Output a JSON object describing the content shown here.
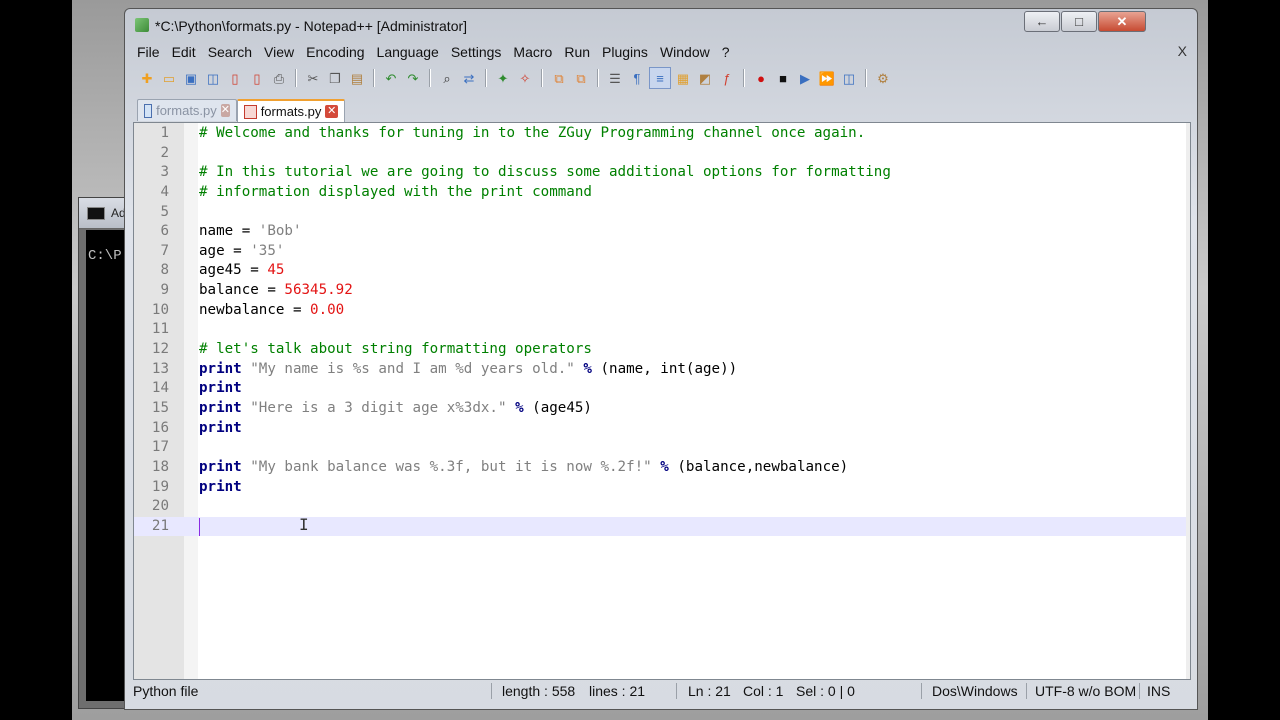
{
  "window": {
    "title": "*C:\\Python\\formats.py - Notepad++ [Administrator]",
    "minimize": "←",
    "maximize": "□",
    "close": "✕"
  },
  "background_console": {
    "title": "Ad",
    "prompt": "C:\\P"
  },
  "menu": {
    "items": [
      "File",
      "Edit",
      "Search",
      "View",
      "Encoding",
      "Language",
      "Settings",
      "Macro",
      "Run",
      "Plugins",
      "Window",
      "?"
    ],
    "close": "X"
  },
  "toolbar": {
    "icons": [
      "new-file-icon",
      "open-file-icon",
      "save-icon",
      "save-all-icon",
      "close-file-icon",
      "close-all-icon",
      "print-icon",
      "cut-icon",
      "copy-icon",
      "paste-icon",
      "undo-icon",
      "redo-icon",
      "find-icon",
      "replace-icon",
      "zoom-in-icon",
      "zoom-out-icon",
      "sync-vertical-icon",
      "sync-horizontal-icon",
      "word-wrap-icon",
      "show-all-chars-icon",
      "indent-guide-icon",
      "user-lang-icon",
      "doc-map-icon",
      "function-list-icon",
      "record-macro-icon",
      "stop-macro-icon",
      "play-macro-icon",
      "run-macro-multiple-icon",
      "save-macro-icon",
      "plugin-icon"
    ]
  },
  "tabs": [
    {
      "label": "formats.py",
      "active": false
    },
    {
      "label": "formats.py",
      "active": true
    }
  ],
  "editor": {
    "lines": [
      {
        "num": "1",
        "tokens": [
          {
            "t": "# Welcome and thanks for tuning in to the ZGuy Programming channel once again.",
            "c": "comment"
          }
        ]
      },
      {
        "num": "2",
        "tokens": []
      },
      {
        "num": "3",
        "tokens": [
          {
            "t": "# In this tutorial we are going to discuss some additional options for formatting",
            "c": "comment"
          }
        ]
      },
      {
        "num": "4",
        "tokens": [
          {
            "t": "# information displayed with the print command",
            "c": "comment"
          }
        ]
      },
      {
        "num": "5",
        "tokens": []
      },
      {
        "num": "6",
        "tokens": [
          {
            "t": "name = ",
            "c": "plain"
          },
          {
            "t": "'Bob'",
            "c": "str"
          }
        ]
      },
      {
        "num": "7",
        "tokens": [
          {
            "t": "age = ",
            "c": "plain"
          },
          {
            "t": "'35'",
            "c": "str"
          }
        ]
      },
      {
        "num": "8",
        "tokens": [
          {
            "t": "age45 = ",
            "c": "plain"
          },
          {
            "t": "45",
            "c": "num"
          }
        ]
      },
      {
        "num": "9",
        "tokens": [
          {
            "t": "balance = ",
            "c": "plain"
          },
          {
            "t": "56345.92",
            "c": "num"
          }
        ]
      },
      {
        "num": "10",
        "tokens": [
          {
            "t": "newbalance = ",
            "c": "plain"
          },
          {
            "t": "0.00",
            "c": "num"
          }
        ]
      },
      {
        "num": "11",
        "tokens": []
      },
      {
        "num": "12",
        "tokens": [
          {
            "t": "# let's talk about string formatting operators",
            "c": "comment"
          }
        ]
      },
      {
        "num": "13",
        "tokens": [
          {
            "t": "print",
            "c": "kw"
          },
          {
            "t": " ",
            "c": "plain"
          },
          {
            "t": "\"My name is %s and I am %d years old.\"",
            "c": "str"
          },
          {
            "t": " ",
            "c": "plain"
          },
          {
            "t": "%",
            "c": "op"
          },
          {
            "t": " (name, int(age))",
            "c": "plain"
          }
        ]
      },
      {
        "num": "14",
        "tokens": [
          {
            "t": "print",
            "c": "kw"
          }
        ]
      },
      {
        "num": "15",
        "tokens": [
          {
            "t": "print",
            "c": "kw"
          },
          {
            "t": " ",
            "c": "plain"
          },
          {
            "t": "\"Here is a 3 digit age x%3dx.\"",
            "c": "str"
          },
          {
            "t": " ",
            "c": "plain"
          },
          {
            "t": "%",
            "c": "op"
          },
          {
            "t": " (age45)",
            "c": "plain"
          }
        ]
      },
      {
        "num": "16",
        "tokens": [
          {
            "t": "print",
            "c": "kw"
          }
        ]
      },
      {
        "num": "17",
        "tokens": []
      },
      {
        "num": "18",
        "tokens": [
          {
            "t": "print",
            "c": "kw"
          },
          {
            "t": " ",
            "c": "plain"
          },
          {
            "t": "\"My bank balance was %.3f, but it is now %.2f!\"",
            "c": "str"
          },
          {
            "t": " ",
            "c": "plain"
          },
          {
            "t": "%",
            "c": "op"
          },
          {
            "t": " (balance,newbalance)",
            "c": "plain"
          }
        ]
      },
      {
        "num": "19",
        "tokens": [
          {
            "t": "print",
            "c": "kw"
          }
        ]
      },
      {
        "num": "20",
        "tokens": []
      },
      {
        "num": "21",
        "tokens": [],
        "current": true
      }
    ],
    "colors": {
      "comment": "#008000",
      "keyword": "#00007f",
      "string": "#808080",
      "number": "#e31414",
      "current_line": "#e8e8ff"
    }
  },
  "status": {
    "language": "Python file",
    "length": "length : 558",
    "lines": "lines : 21",
    "ln": "Ln : 21",
    "col": "Col : 1",
    "sel": "Sel : 0 | 0",
    "eol": "Dos\\Windows",
    "encoding": "UTF-8 w/o BOM",
    "mode": "INS"
  }
}
